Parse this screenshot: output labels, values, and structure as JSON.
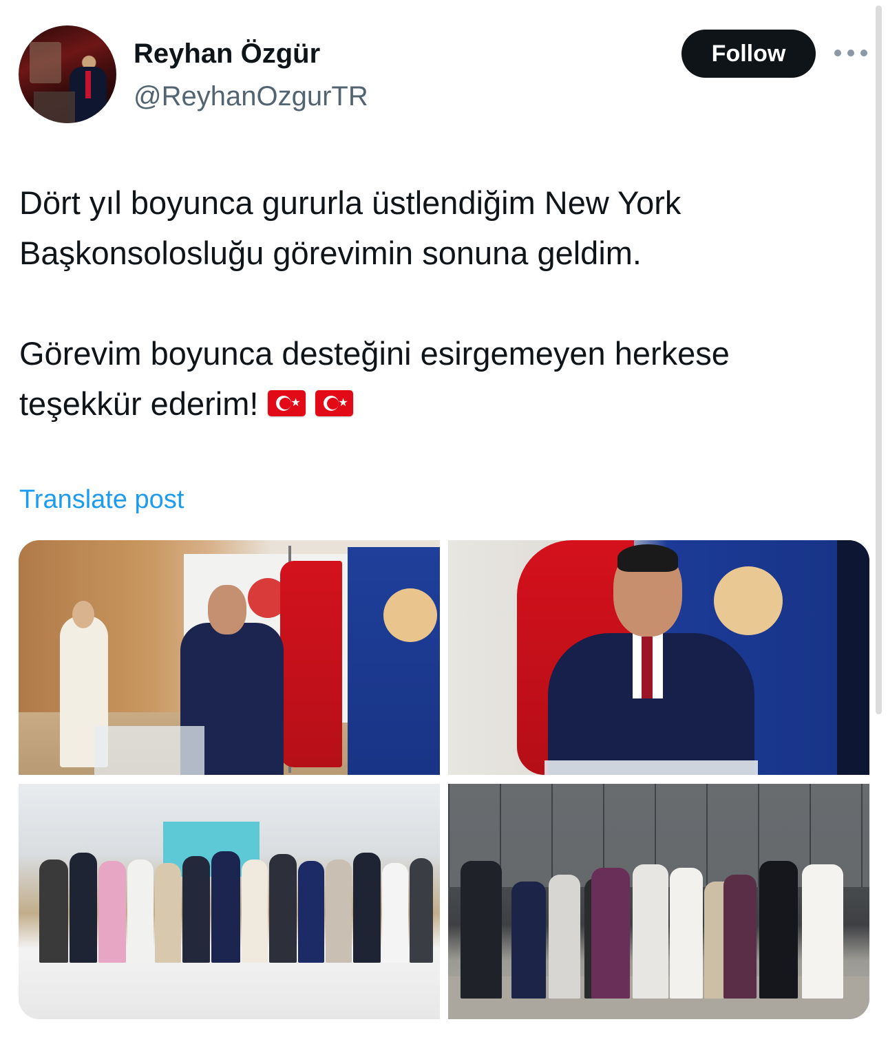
{
  "author": {
    "name": "Reyhan Özgür",
    "handle": "@ReyhanOzgurTR",
    "follow_label": "Follow"
  },
  "tweet": {
    "paragraph1": {
      "line1": "Dört yıl boyunca gururla üstlendiğim New York",
      "line2": "Başkonsolosluğu görevimin sonuna geldim."
    },
    "paragraph2": {
      "line1": "Görevim boyunca desteğini esirgemeyen herkese",
      "line2": "teşekkür ederim!"
    },
    "emoji": [
      "turkey-flag",
      "turkey-flag"
    ]
  },
  "translate_label": "Translate post",
  "colors": {
    "text": "#0f1419",
    "secondary": "#536471",
    "link": "#1d9bf0",
    "button_bg": "#0f1419",
    "turkey_red": "#e30a17"
  }
}
